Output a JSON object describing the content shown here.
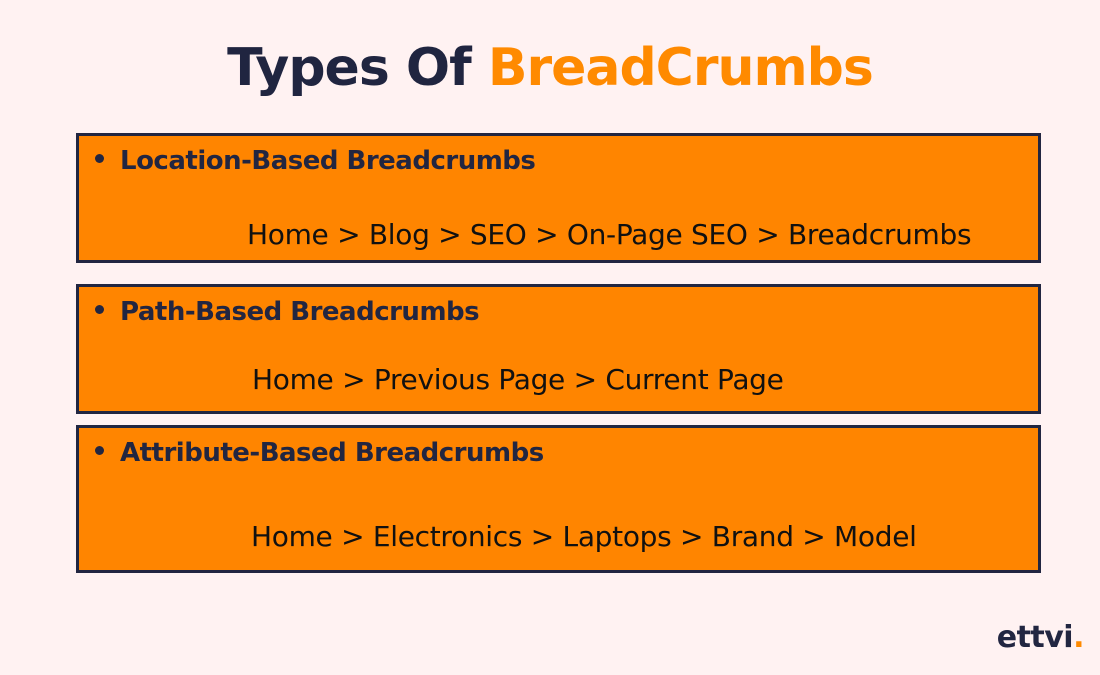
{
  "title": {
    "part1": "Types Of ",
    "part2": "BreadCrumbs"
  },
  "items": [
    {
      "heading": "Location-Based Breadcrumbs",
      "example": "Home > Blog > SEO > On-Page SEO > Breadcrumbs"
    },
    {
      "heading": "Path-Based Breadcrumbs",
      "example": "Home > Previous Page > Current Page"
    },
    {
      "heading": "Attribute-Based Breadcrumbs",
      "example": "Home > Electronics > Laptops > Brand > Model"
    }
  ],
  "logo": {
    "text": "ettvi",
    "dot": "."
  },
  "colors": {
    "accent": "#ff8500",
    "dark": "#222641",
    "background": "#fff2f2"
  }
}
